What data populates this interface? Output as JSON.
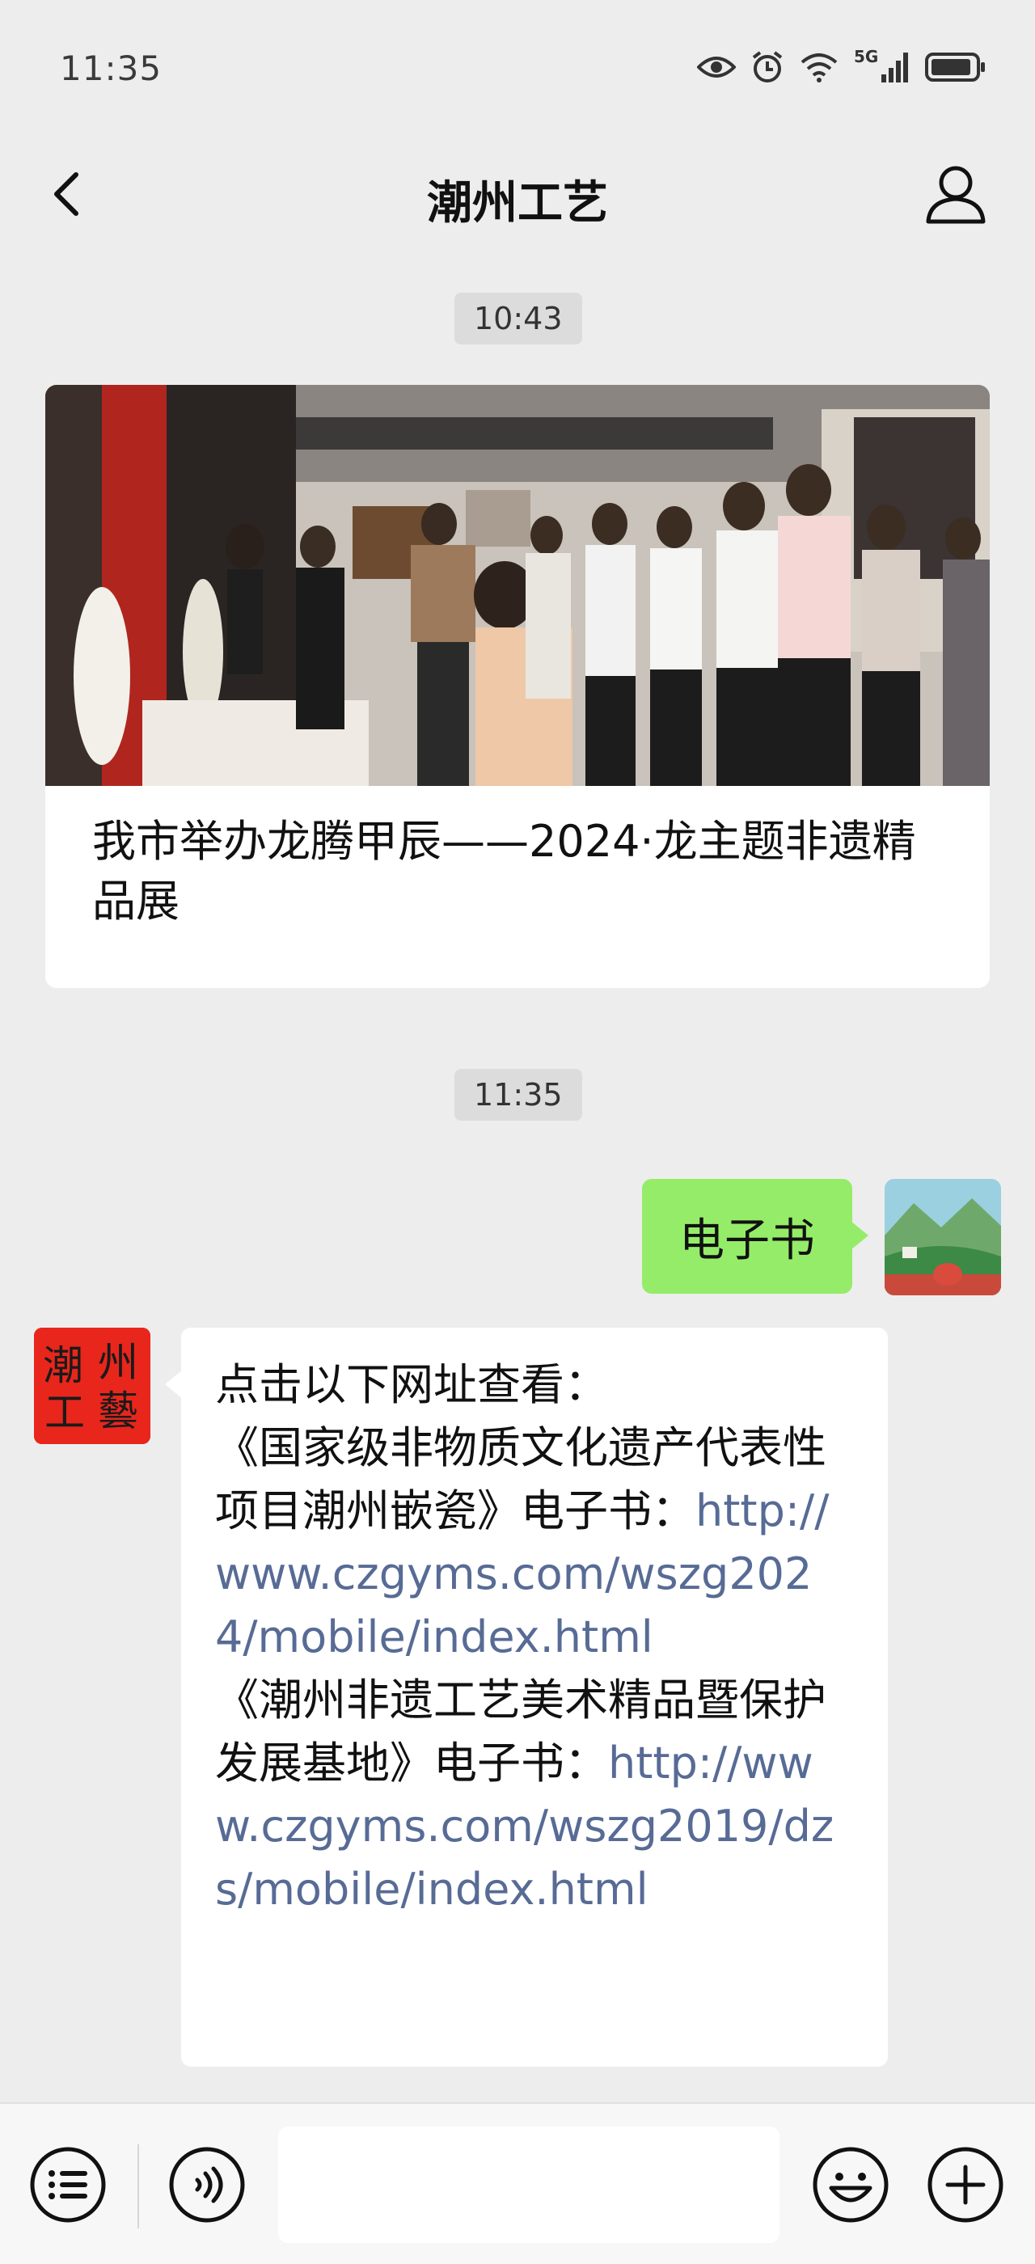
{
  "status_bar": {
    "time": "11:35",
    "net_label": "5G"
  },
  "nav": {
    "title": "潮州工艺"
  },
  "timestamps": [
    "10:43",
    "11:35"
  ],
  "article": {
    "title": "我市举办龙腾甲辰——2024·龙主题非遗精品展"
  },
  "chat": {
    "sent_text": "电子书",
    "received": {
      "line1": "点击以下网址查看：",
      "book1_title": "《国家级非物质文化遗产代表性项目潮州嵌瓷》电子书：",
      "link1": "http://www.czgyms.com/wszg2024/mobile/index.html",
      "book2_title": "《潮州非遗工艺美术精品暨保护发展基地》电子书：",
      "link2": "http://www.czgyms.com/wszg2019/dzs/mobile/index.html"
    }
  },
  "brand_avatar": {
    "chars": [
      "潮",
      "州",
      "工",
      "藝"
    ],
    "bg_color": "#e8261c"
  },
  "colors": {
    "accent_green": "#95ec69",
    "link": "#576b95",
    "background": "#ededed"
  },
  "icons": [
    "eye-icon",
    "alarm-icon",
    "wifi-icon",
    "signal-icon",
    "battery-icon",
    "back-icon",
    "profile-icon",
    "menu-list-icon",
    "voice-icon",
    "emoji-icon",
    "plus-icon"
  ]
}
